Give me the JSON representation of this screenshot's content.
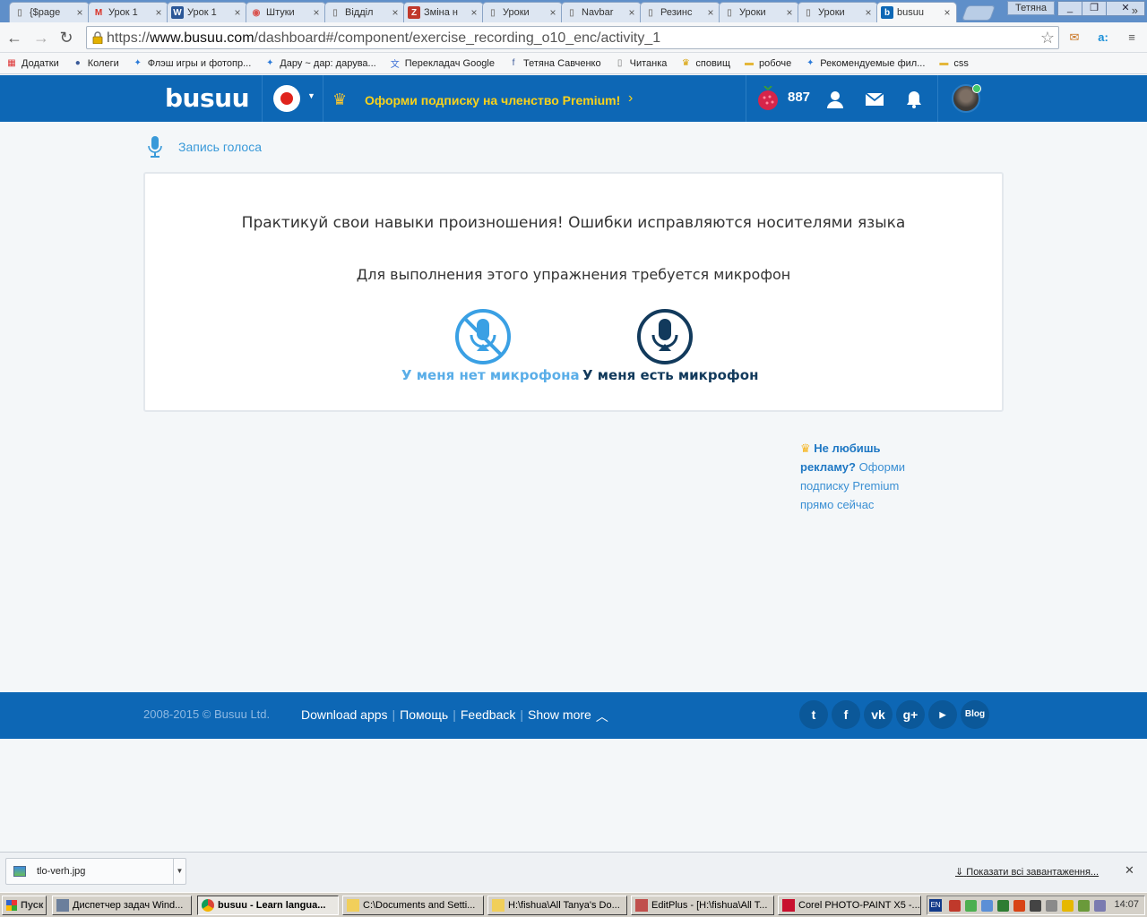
{
  "browser": {
    "tabs": [
      {
        "title": "{$page",
        "icon": "document-icon"
      },
      {
        "title": "Урок 1",
        "icon": "gmail-icon"
      },
      {
        "title": "Урок 1",
        "icon": "word-icon"
      },
      {
        "title": "Штуки",
        "icon": "site-icon"
      },
      {
        "title": "Відділ",
        "icon": "document-icon"
      },
      {
        "title": "Зміна н",
        "icon": "znu-icon"
      },
      {
        "title": "Уроки",
        "icon": "document-icon"
      },
      {
        "title": "Navbar",
        "icon": "document-icon"
      },
      {
        "title": "Резинс",
        "icon": "document-icon"
      },
      {
        "title": "Уроки",
        "icon": "document-icon"
      },
      {
        "title": "Уроки",
        "icon": "document-icon"
      },
      {
        "title": "busuu",
        "icon": "busuu-icon",
        "active": true
      }
    ],
    "profile_name": "Тетяна",
    "url_scheme": "https://",
    "url_host": "www.busuu.com",
    "url_path": "/dashboard#/component/exercise_recording_o10_enc/activity_1",
    "bookmarks": [
      {
        "label": "Додатки",
        "icon": "apps-icon"
      },
      {
        "label": "Колеги",
        "icon": "person-icon"
      },
      {
        "label": "Флэш игры и фотопр...",
        "icon": "site-icon"
      },
      {
        "label": "Дару ~ дар: дарува...",
        "icon": "site-icon"
      },
      {
        "label": "Перекладач Google",
        "icon": "translate-icon"
      },
      {
        "label": "Тетяна Савченко",
        "icon": "facebook-icon"
      },
      {
        "label": "Читанка",
        "icon": "document-icon"
      },
      {
        "label": "сповищ",
        "icon": "crown-icon"
      },
      {
        "label": "робоче",
        "icon": "folder-icon"
      },
      {
        "label": "Рекомендуемые фил...",
        "icon": "site-icon"
      },
      {
        "label": "css",
        "icon": "folder-icon"
      }
    ]
  },
  "header": {
    "logo": "busuu",
    "premium_text": "Оформи подписку на членство Premium!",
    "berry_count": "887"
  },
  "breadcrumb": {
    "label": "Запись голоса"
  },
  "exercise": {
    "heading": "Практикуй свои навыки произношения! Ошибки исправляются носителями языка",
    "subheading": "Для выполнения этого упражнения требуется микрофон",
    "no_mic_label": "У меня нет микрофона",
    "has_mic_label": "У меня есть микрофон"
  },
  "ad_note": {
    "bold_text": "Не любишь рекламу?",
    "text": "Оформи подписку Premium прямо сейчас"
  },
  "footer": {
    "copyright": "2008-2015 © Busuu Ltd.",
    "links": [
      "Download apps",
      "Помощь",
      "Feedback",
      "Show more"
    ],
    "social": [
      "twitter",
      "facebook",
      "vk",
      "google-plus",
      "youtube"
    ],
    "blog_label": "Blog"
  },
  "downloads": {
    "file_name": "tlo-verh.jpg",
    "show_all": "Показати всі завантаження..."
  },
  "taskbar": {
    "start_label": "Пуск",
    "tasks": [
      "Диспетчер задач Wind...",
      "busuu - Learn langua...",
      "C:\\Documents and Setti...",
      "H:\\fishua\\All Tanya's Do...",
      "EditPlus - [H:\\fishua\\All T...",
      "Corel PHOTO-PAINT X5 -..."
    ],
    "lang_indicator": "EN",
    "clock": "14:07"
  }
}
